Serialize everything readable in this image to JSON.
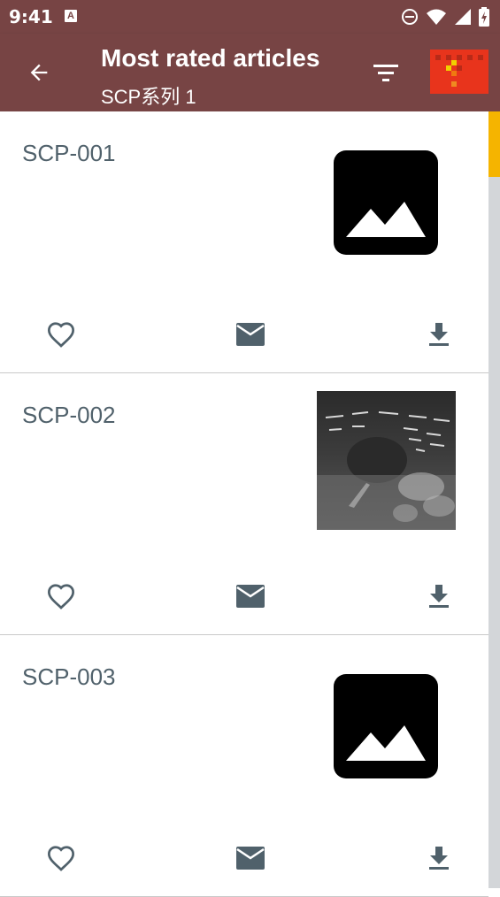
{
  "status_bar": {
    "time": "9:41",
    "notification_glyph": "A",
    "icons": [
      "dnd-icon",
      "wifi-icon",
      "signal-icon",
      "battery-icon"
    ]
  },
  "app_bar": {
    "title": "Most rated articles",
    "subtitle": "SCP系列 1",
    "color": "#774444"
  },
  "articles": [
    {
      "title": "SCP-001",
      "image": "placeholder"
    },
    {
      "title": "SCP-002",
      "image": "photo"
    },
    {
      "title": "SCP-003",
      "image": "placeholder"
    }
  ],
  "actions": [
    "favorite-icon",
    "mail-icon",
    "download-icon"
  ],
  "colors": {
    "accent": "#f5b400",
    "text_secondary": "#50616b",
    "icon": "#50616b"
  },
  "scroll": {
    "position_fraction": 0.0,
    "thumb_fraction": 0.084
  }
}
